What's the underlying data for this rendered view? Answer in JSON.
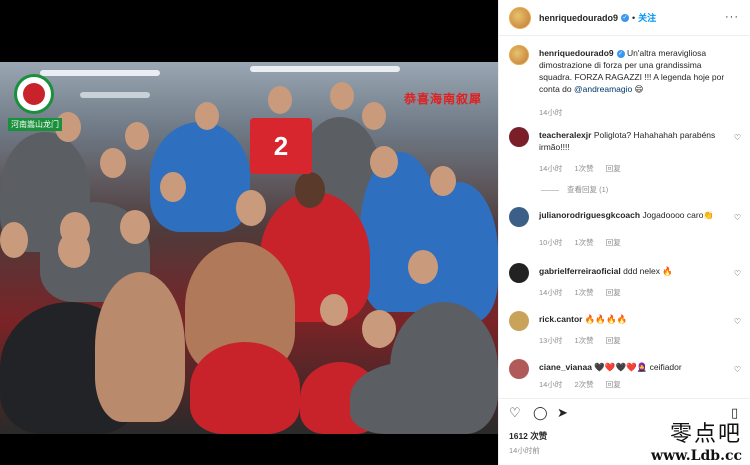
{
  "post": {
    "author": "henriquedourado9",
    "follow_label": "关注",
    "more_label": "···",
    "photo_caption": "恭喜海南叙犀",
    "shirt_number": "2",
    "club_logo_text": "河南嵩山龙门",
    "caption_user": "henriquedourado9",
    "caption_text": "Un'altra meravigliosa dimostrazione di forza per una grandissima squadra. FORZA RAGAZZI !!! A legenda hoje por conta do",
    "caption_mention": "@andreamagio",
    "caption_emoji": "😄",
    "caption_time": "14小时",
    "likes": "1612 次赞",
    "time": "14小时前"
  },
  "comments": [
    {
      "user": "teacheralexjr",
      "text": "Poliglota? Hahahahah parabéns irmão!!!!",
      "time": "14小时",
      "likes": "1次赞",
      "reply": "回复",
      "view_replies": "查看回复 (1)",
      "avatar_color": "#7a1f2a"
    },
    {
      "user": "julianorodriguesgkcoach",
      "text": "Jogadoooo caro👏",
      "time": "10小时",
      "likes": "1次赞",
      "reply": "回复",
      "avatar_color": "#3b5f86"
    },
    {
      "user": "gabrielferreiraoficial",
      "text": "ddd nelex 🔥",
      "time": "14小时",
      "likes": "1次赞",
      "reply": "回复",
      "avatar_color": "#222222"
    },
    {
      "user": "rick.cantor",
      "text": "🔥🔥🔥🔥",
      "time": "13小时",
      "likes": "1次赞",
      "reply": "回复",
      "avatar_color": "#c9a35a"
    },
    {
      "user": "ciane_vianaa",
      "text": "🖤❤️🖤❤️🧕 ceifiador",
      "time": "14小时",
      "likes": "2次赞",
      "reply": "回复",
      "avatar_color": "#b05a5a"
    }
  ],
  "icons": {
    "like": "heart-outline-icon",
    "comment": "comment-icon",
    "share": "paper-plane-icon",
    "save": "bookmark-icon"
  },
  "watermark": {
    "cn": "零点吧",
    "url": "www.Ldb.cc"
  },
  "colors": {
    "follow_blue": "#0095f6",
    "verified_blue": "#3897f0",
    "meta_grey": "#8e8e8e"
  }
}
